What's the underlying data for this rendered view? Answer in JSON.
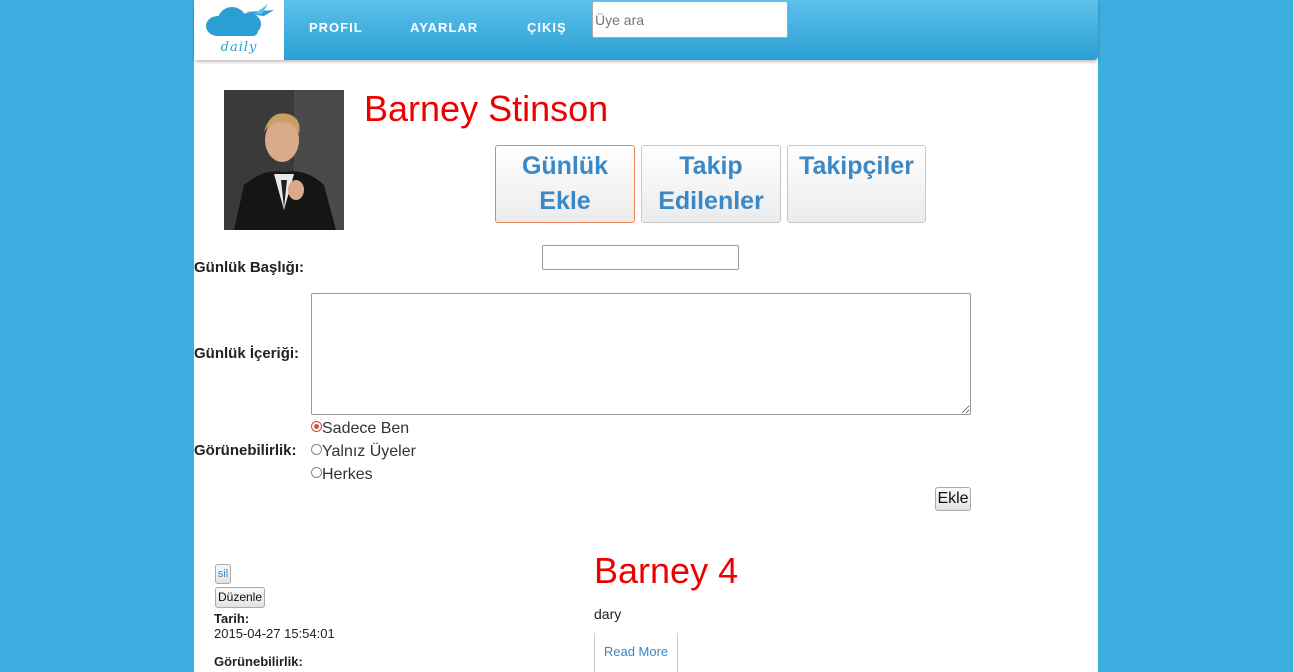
{
  "header": {
    "logo_text": "daily",
    "nav": [
      "PROFIL",
      "AYARLAR",
      "ÇIKIŞ"
    ],
    "search_placeholder": "Üye ara"
  },
  "profile": {
    "name": "Barney Stinson",
    "tabs": [
      "Günlük Ekle",
      "Takip Edilenler",
      "Takipçiler"
    ]
  },
  "form": {
    "title_label": "Günlük Başlığı:",
    "content_label": "Günlük İçeriği:",
    "visibility_label": "Görünebilirlik:",
    "visibility_options": [
      "Sadece Ben",
      "Yalnız Üyeler",
      "Herkes"
    ],
    "selected_visibility": "Sadece Ben",
    "submit_label": "Ekle"
  },
  "post": {
    "delete_label": "sil",
    "edit_label": "Düzenle",
    "date_label": "Tarih:",
    "date_value": "2015-04-27 15:54:01",
    "visibility_label": "Görünebilirlik:",
    "title": "Barney 4",
    "body": "dary",
    "read_more": "Read More"
  },
  "colors": {
    "background": "#3daee0",
    "header": "#2b9fd4",
    "accent_red": "#ee0000",
    "link_blue": "#3a88c6"
  }
}
